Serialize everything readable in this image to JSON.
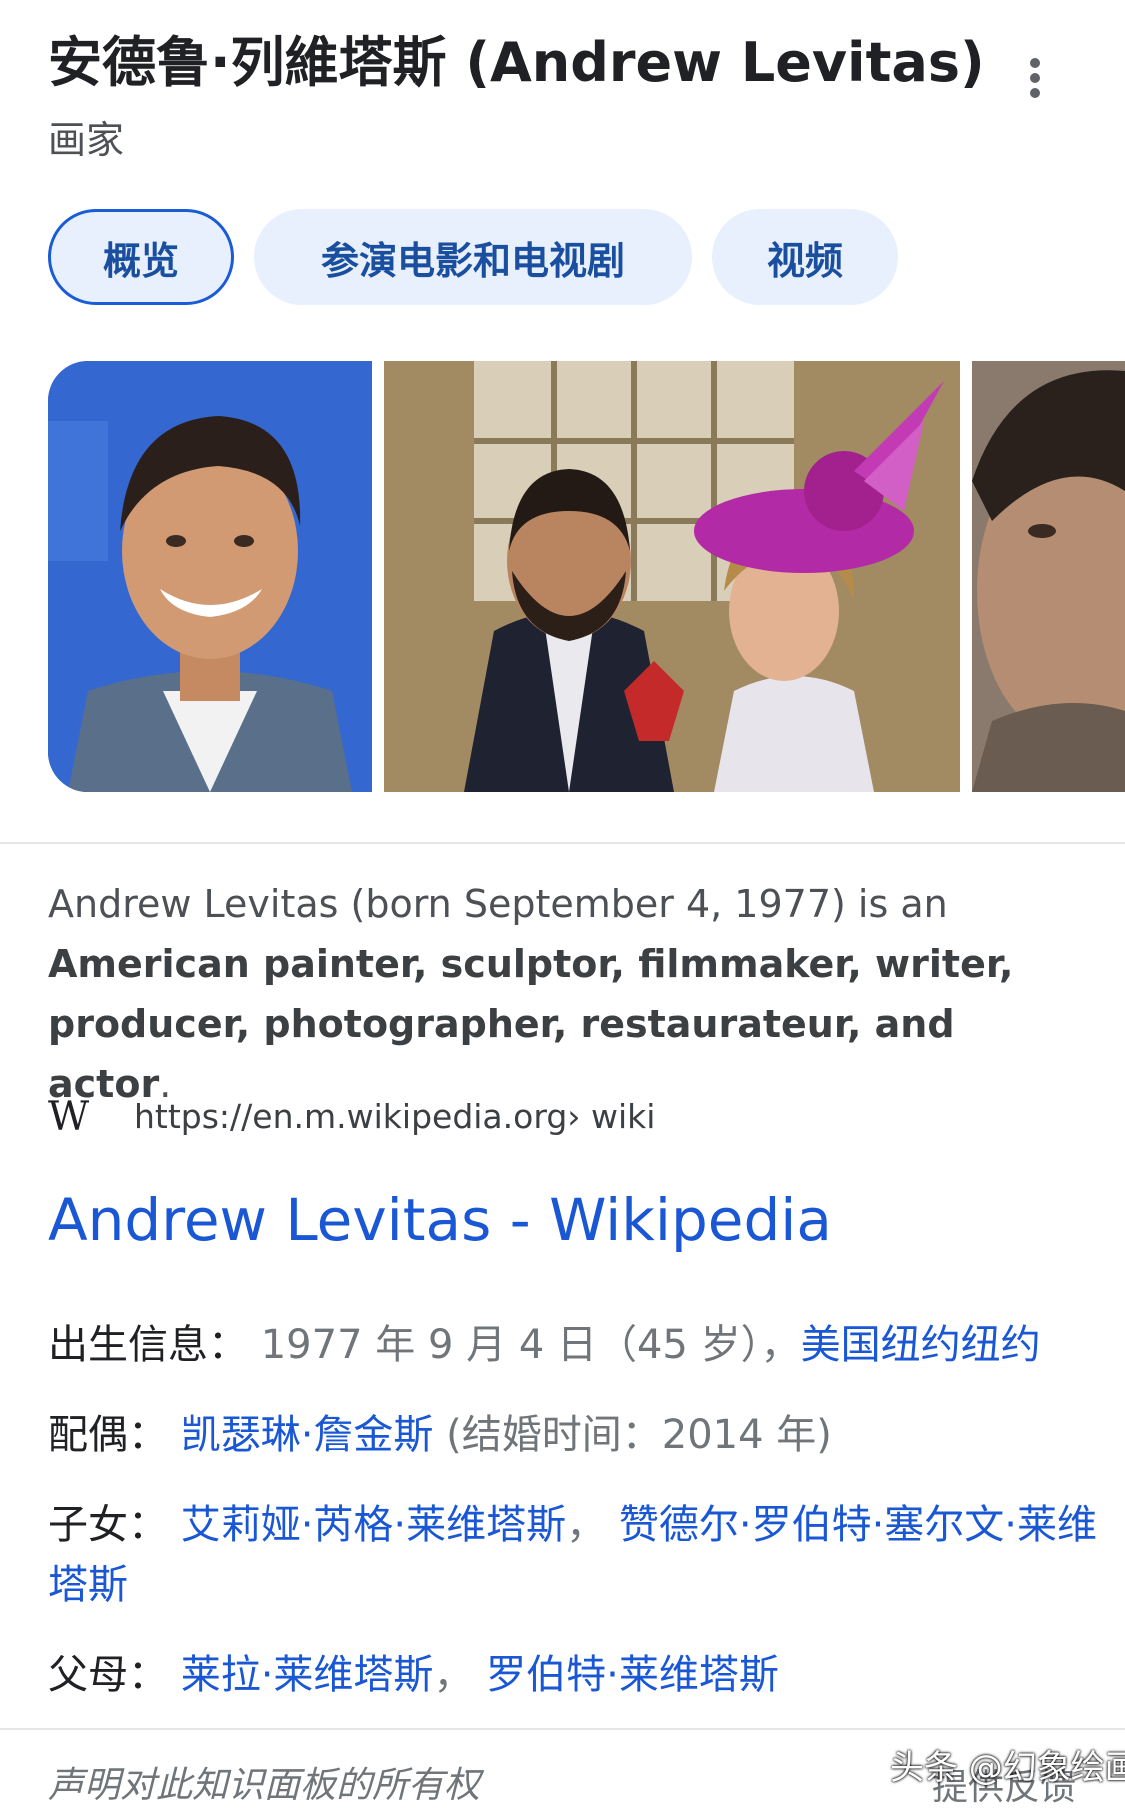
{
  "header": {
    "title": "安德鲁·列維塔斯 (Andrew Levitas)",
    "subtitle": "画家",
    "more_icon": "more-vert-icon"
  },
  "tabs": [
    {
      "label": "概览",
      "active": true
    },
    {
      "label": "参演电影和电视剧",
      "active": false
    },
    {
      "label": "视频",
      "active": false
    }
  ],
  "description": {
    "plain": "Andrew Levitas (born September 4, 1977) is an ",
    "bold": "American painter, sculptor, filmmaker, writer, producer, photographer, restaurateur, and actor",
    "end": "."
  },
  "source": {
    "icon": "wikipedia-icon",
    "url": "https://en.m.wikipedia.org",
    "path": " › wiki",
    "link_title": "Andrew Levitas - Wikipedia"
  },
  "facts": {
    "birth": {
      "label": "出生信息：",
      "value": " 1977 年 9 月 4 日（45 岁），",
      "place": "美国纽约纽约"
    },
    "spouse": {
      "label": "配偶：",
      "name": "凯瑟琳·詹金斯",
      "note": " (结婚时间：2014 年)"
    },
    "children": {
      "label": "子女：",
      "child1": "艾莉娅·芮格·莱维塔斯",
      "sep": "，",
      "child2": "赞德尔·罗伯特·塞尔文·莱维塔斯"
    },
    "parents": {
      "label": "父母：",
      "parent1": "莱拉·莱维塔斯",
      "sep": "，",
      "parent2": "罗伯特·莱维塔斯"
    }
  },
  "footer": {
    "claim": "声明对此知识面板的所有权",
    "feedback": "提供反馈"
  },
  "watermark": "头条 @幻象绘画",
  "colors": {
    "link": "#1a57d4",
    "tab_bg": "#e8f0fe",
    "tab_border": "#1a5bd6"
  }
}
